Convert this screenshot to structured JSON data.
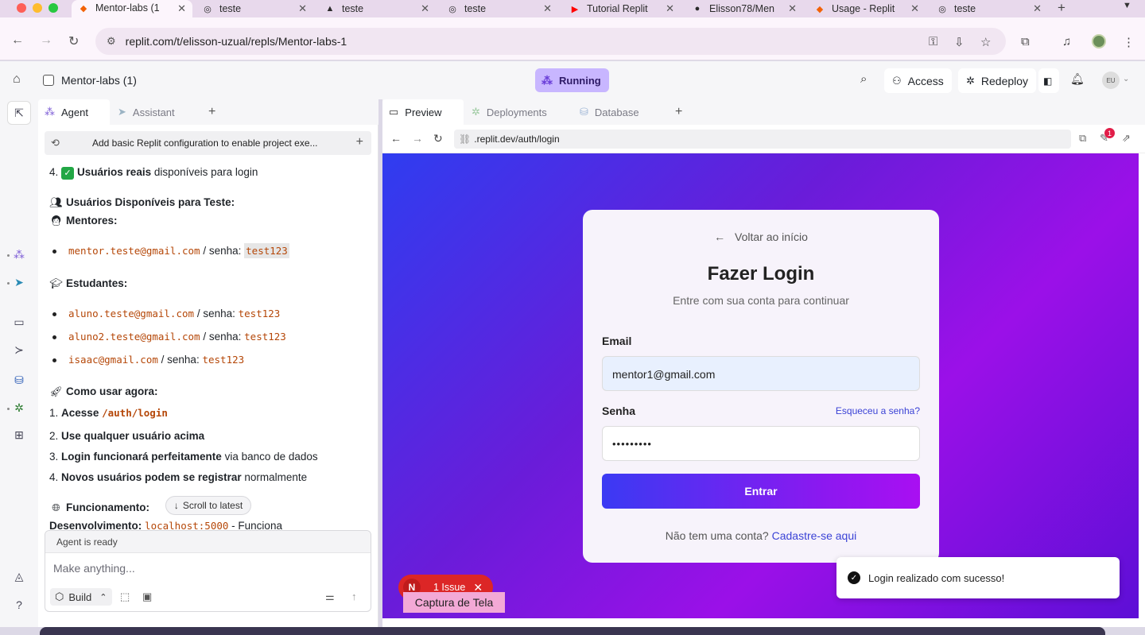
{
  "browser": {
    "tabs": [
      {
        "title": "Mentor-labs (1",
        "icon": "replit-icon",
        "active": true
      },
      {
        "title": "teste",
        "icon": "globe-icon"
      },
      {
        "title": "teste",
        "icon": "triangle-icon"
      },
      {
        "title": "teste",
        "icon": "globe-icon"
      },
      {
        "title": "Tutorial Replit",
        "icon": "youtube-icon"
      },
      {
        "title": "Elisson78/Men",
        "icon": "github-icon"
      },
      {
        "title": "Usage - Replit",
        "icon": "replit-icon"
      },
      {
        "title": "teste",
        "icon": "globe-icon"
      }
    ],
    "url": "replit.com/t/elisson-uzual/repls/Mentor-labs-1"
  },
  "header": {
    "project_name": "Mentor-labs (1)",
    "run_status": "Running",
    "access_label": "Access",
    "redeploy_label": "Redeploy",
    "avatar_initials": "EU"
  },
  "left_panel": {
    "tabs": [
      {
        "label": "Agent",
        "active": true
      },
      {
        "label": "Assistant"
      }
    ],
    "history_title": "Add basic Replit configuration to enable project exe...",
    "message": {
      "item4_prefix": "4.",
      "item4_bold": "Usuários reais",
      "item4_rest": "disponíveis para login",
      "users_heading": "Usuários Disponíveis para Teste:",
      "mentors_heading": "Mentores:",
      "mentors": [
        {
          "email": "mentor.teste@gmail.com",
          "sep": "/ senha:",
          "password": "test123"
        }
      ],
      "students_heading": "Estudantes:",
      "students": [
        {
          "email": "aluno.teste@gmail.com",
          "sep": "/ senha:",
          "password": "test123"
        },
        {
          "email": "aluno2.teste@gmail.com",
          "sep": "/ senha:",
          "password": "test123"
        },
        {
          "email": "isaac@gmail.com",
          "sep": "/ senha:",
          "password": "test123"
        }
      ],
      "howto_heading": "Como usar agora:",
      "steps": [
        {
          "num": "1.",
          "bold": "Acesse",
          "code": "/auth/login",
          "rest": ""
        },
        {
          "num": "2.",
          "bold": "Use qualquer usuário acima",
          "code": "",
          "rest": ""
        },
        {
          "num": "3.",
          "bold": "Login funcionará perfeitamente",
          "code": "",
          "rest": "via banco de dados"
        },
        {
          "num": "4.",
          "bold": "Novos usuários podem se registrar",
          "code": "",
          "rest": "normalmente"
        }
      ],
      "functioning_heading": "Funcionamento:",
      "dev_label": "Desenvolvimento:",
      "dev_code": "localhost:5000",
      "dev_rest": "- Funciona"
    },
    "scroll_to_latest": "Scroll to latest",
    "composer": {
      "status": "Agent is ready",
      "placeholder": "Make anything...",
      "mode": "Build"
    }
  },
  "preview": {
    "tabs": [
      {
        "label": "Preview",
        "active": true
      },
      {
        "label": "Deployments"
      },
      {
        "label": "Database"
      }
    ],
    "url": ".replit.dev/auth/login",
    "devtools_badge": "1",
    "login": {
      "back_label": "Voltar ao início",
      "title": "Fazer Login",
      "subtitle": "Entre com sua conta para continuar",
      "email_label": "Email",
      "email_value": "mentor1@gmail.com",
      "password_label": "Senha",
      "password_value": "•••••••••",
      "forgot_label": "Esqueceu a senha?",
      "submit_label": "Entrar",
      "signup_prompt": "Não tem uma conta?",
      "signup_link": "Cadastre-se aqui"
    },
    "issue_avatar": "N",
    "issue_label": "1 Issue",
    "capture_label": "Captura de Tela",
    "toast": "Login realizado com sucesso!"
  }
}
